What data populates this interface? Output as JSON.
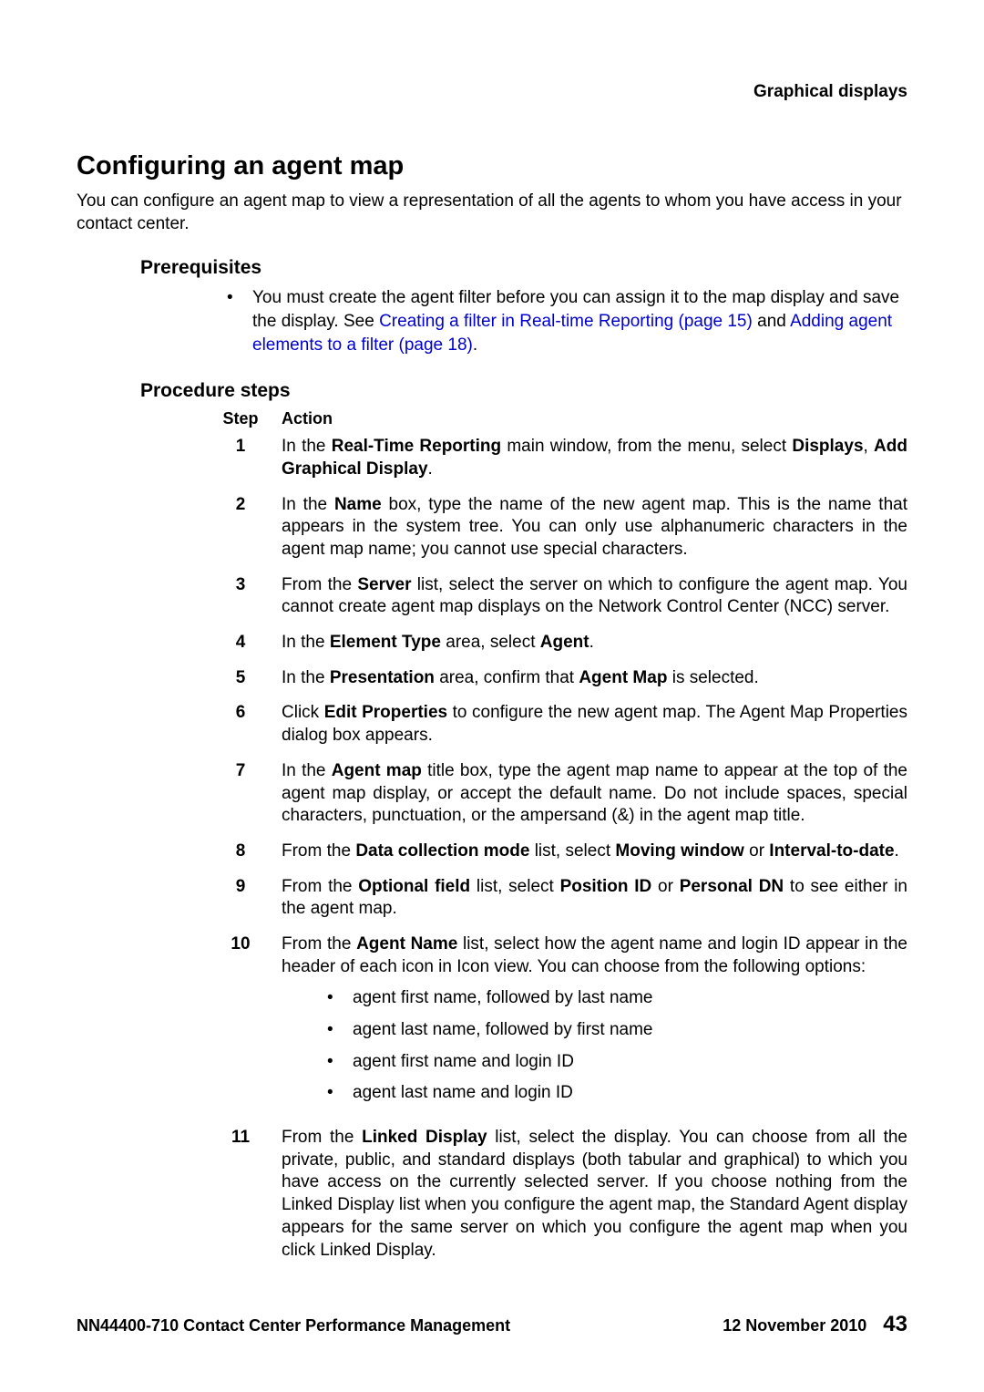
{
  "running_header": "Graphical displays",
  "section_title": "Configuring an agent map",
  "intro": "You can configure an agent map to view a representation of all the agents to whom you have access in your contact center.",
  "prereq_heading": "Prerequisites",
  "prereq_item_pre": "You must create the agent filter before you can assign it to the map display and save the display. See ",
  "prereq_link1": "Creating a filter in Real-time Reporting (page 15)",
  "prereq_mid": " and ",
  "prereq_link2": "Adding agent elements to a filter (page 18)",
  "prereq_post": ".",
  "procedure_heading": "Procedure steps",
  "col_step": "Step",
  "col_action": "Action",
  "steps": {
    "s1a": "In the ",
    "s1b": "Real-Time Reporting",
    "s1c": " main window, from the menu, select ",
    "s1d": "Displays",
    "s1e": ", ",
    "s1f": "Add Graphical Display",
    "s1g": ".",
    "s2a": "In the ",
    "s2b": "Name",
    "s2c": " box, type the name of the new agent map. This is the name that appears in the system tree. You can only use alphanumeric characters in the agent map name; you cannot use special characters.",
    "s3a": "From the ",
    "s3b": "Server",
    "s3c": " list, select the server on which to configure the agent map. You cannot create agent map displays on the Network Control Center (NCC) server.",
    "s4a": "In the ",
    "s4b": "Element Type",
    "s4c": " area, select ",
    "s4d": "Agent",
    "s4e": ".",
    "s5a": "In the ",
    "s5b": "Presentation",
    "s5c": " area, confirm that ",
    "s5d": "Agent Map",
    "s5e": " is selected.",
    "s6a": "Click ",
    "s6b": "Edit Properties",
    "s6c": " to configure the new agent map. The Agent Map Properties dialog box appears.",
    "s7a": "In the ",
    "s7b": "Agent map",
    "s7c": " title box, type the agent map name to appear at the top of the agent map display, or accept the default name. Do not include spaces, special characters, punctuation, or the ampersand (&) in the agent map title.",
    "s8a": "From the ",
    "s8b": "Data collection mode",
    "s8c": " list, select ",
    "s8d": "Moving window",
    "s8e": " or ",
    "s8f": "Interval-to-date",
    "s8g": ".",
    "s9a": "From the ",
    "s9b": "Optional field",
    "s9c": " list, select ",
    "s9d": "Position ID",
    "s9e": " or ",
    "s9f": "Personal DN",
    "s9g": " to see either in the agent map.",
    "s10a": "From the ",
    "s10b": "Agent Name",
    "s10c": " list, select how the agent name and login ID appear in the header of each icon in Icon view. You can choose from the following options:",
    "s10_opt1": "agent first name, followed by last name",
    "s10_opt2": "agent last name, followed by first name",
    "s10_opt3": "agent first name and login ID",
    "s10_opt4": "agent last name and login ID",
    "s11a": "From the ",
    "s11b": "Linked Display",
    "s11c": " list, select the display. You can choose from all the private, public, and standard displays (both tabular and graphical) to which you have access on the currently selected server. If you choose nothing from the Linked Display list when you configure the agent map, the Standard Agent display appears for the same server on which you configure the agent map when you click Linked Display."
  },
  "footer": {
    "left": "NN44400-710 Contact Center Performance Management",
    "date": "12 November 2010",
    "page": "43"
  }
}
